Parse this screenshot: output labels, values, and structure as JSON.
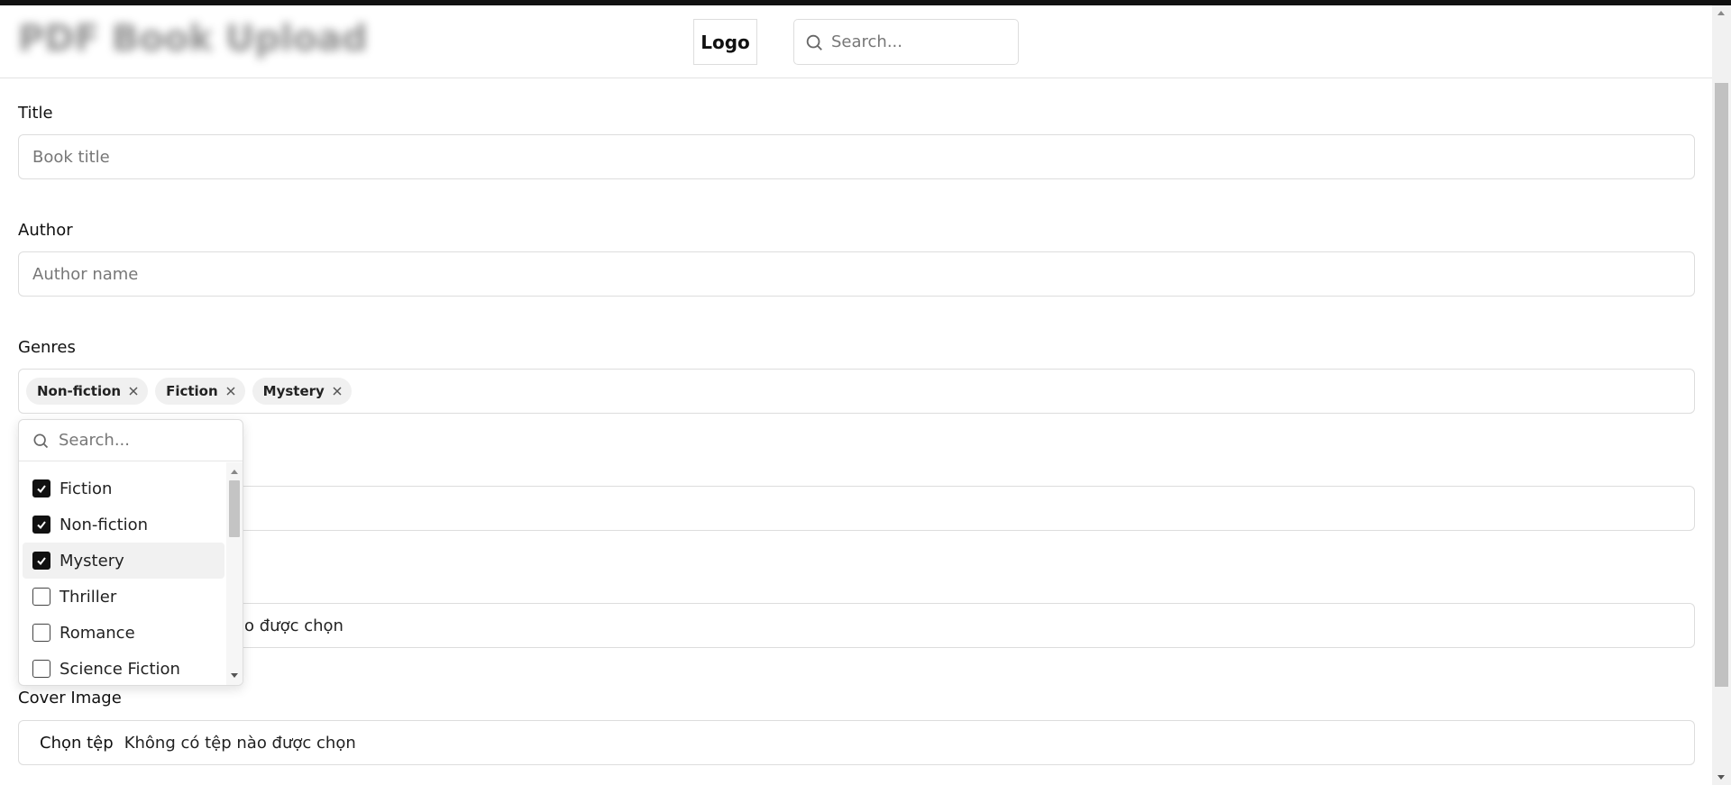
{
  "header": {
    "title": "PDF Book Upload",
    "logo": "Logo",
    "search_placeholder": "Search..."
  },
  "form": {
    "title_label": "Title",
    "title_placeholder": "Book title",
    "author_label": "Author",
    "author_placeholder": "Author name",
    "genres_label": "Genres",
    "selected_genres": [
      "Non-fiction",
      "Fiction",
      "Mystery"
    ],
    "pdf_file_status_partial": "o được chọn",
    "cover_label": "Cover Image",
    "cover_button": "Chọn tệp",
    "cover_status": "Không có tệp nào được chọn"
  },
  "genre_dropdown": {
    "search_placeholder": "Search...",
    "options": [
      {
        "label": "Fiction",
        "checked": true
      },
      {
        "label": "Non-fiction",
        "checked": true
      },
      {
        "label": "Mystery",
        "checked": true,
        "hovered": true
      },
      {
        "label": "Thriller",
        "checked": false
      },
      {
        "label": "Romance",
        "checked": false
      },
      {
        "label": "Science Fiction",
        "checked": false
      }
    ]
  },
  "icons": {
    "search": "search-icon",
    "remove": "close-icon",
    "check": "check-icon"
  },
  "colors": {
    "accent": "#111111",
    "border": "#dddddd",
    "chip_bg": "#f0f0f0"
  }
}
